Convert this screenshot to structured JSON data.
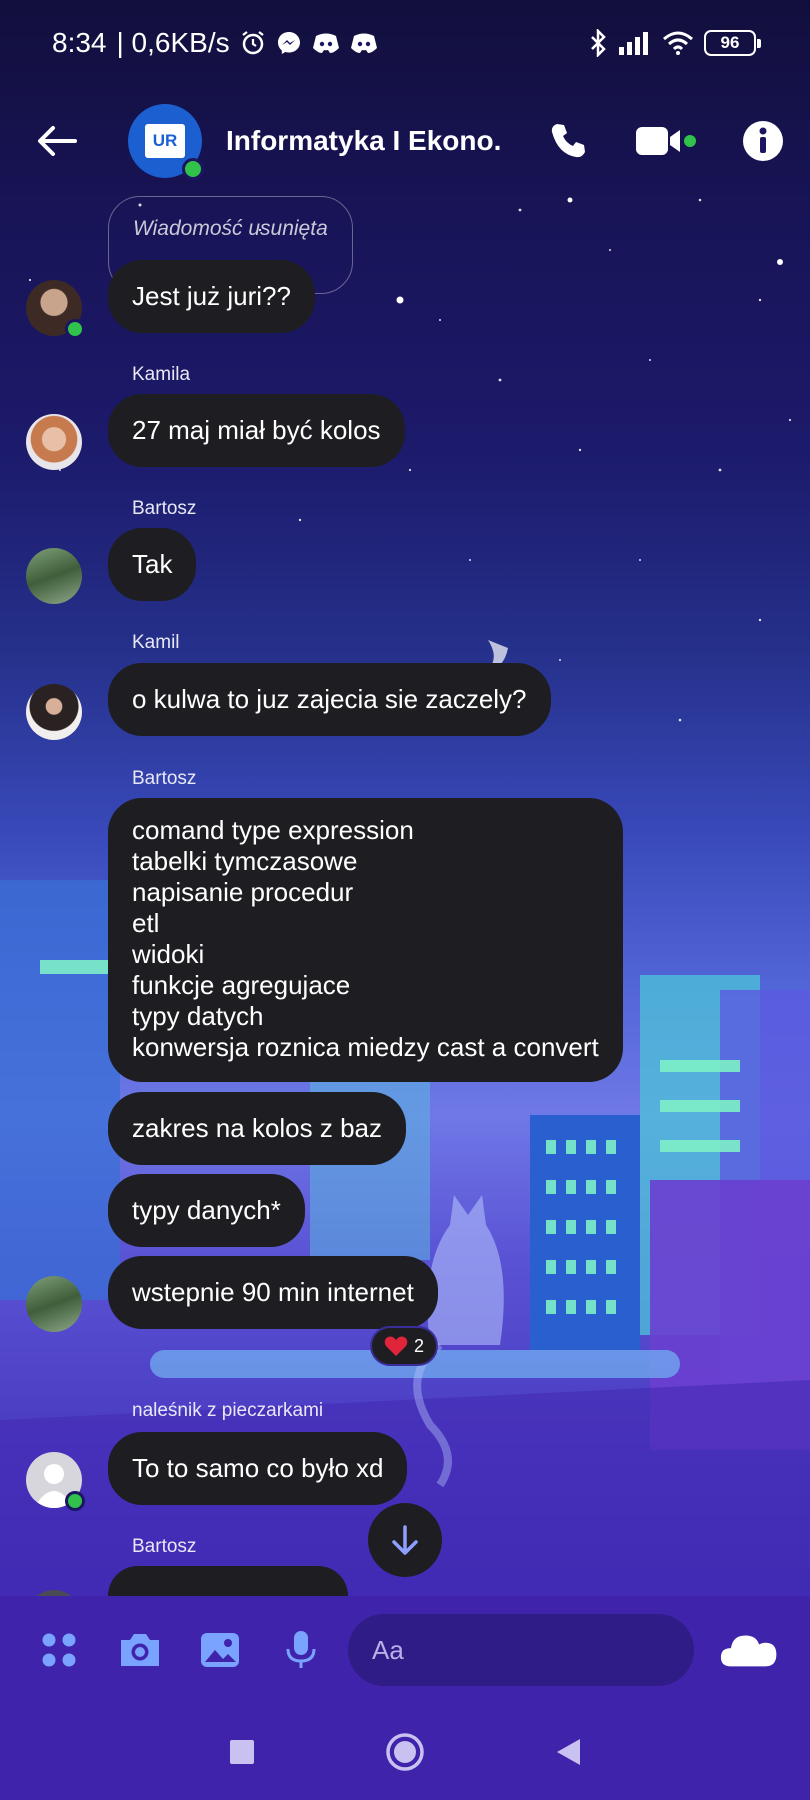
{
  "status_bar": {
    "time": "8:34",
    "speed": "| 0,6KB/s",
    "battery": "96",
    "icons": [
      "alarm-icon",
      "messenger-icon",
      "discord-icon",
      "discord-icon",
      "bluetooth-icon",
      "signal-icon",
      "wifi-icon",
      "battery-icon"
    ]
  },
  "header": {
    "title": "Informatyka I Ekono...",
    "avatar_logo": "UR",
    "icons": [
      "back-arrow-icon",
      "phone-icon",
      "video-camera-icon",
      "info-icon"
    ]
  },
  "messages": {
    "deleted": "Wiadomość usunięta",
    "m1": "Jest już juri??",
    "kamila_name": "Kamila",
    "m2": "27 maj miał być kolos",
    "bartosz_name": "Bartosz",
    "m3": "Tak",
    "kamil_name": "Kamil",
    "m4": "o kulwa to juz zajecia sie zaczely?",
    "bartosz_name_2": "Bartosz",
    "m5_lines": [
      "comand type expression",
      "tabelki tymczasowe",
      "napisanie procedur",
      "etl",
      "widoki",
      "funkcje agregujace",
      "typy datych",
      "konwersja roznica miedzy cast a convert"
    ],
    "m6": "zakres na kolos z baz",
    "m7": "typy danych*",
    "m8": "wstepnie 90 min internet",
    "reaction_count": "2",
    "nalesnik_name": "naleśnik z pieczarkami",
    "m9": "To to samo co było xd",
    "bartosz_name_3": "Bartosz"
  },
  "composer": {
    "placeholder": "Aa",
    "icons": [
      "menu-dots-icon",
      "camera-icon",
      "gallery-icon",
      "microphone-icon",
      "emoji-icon",
      "cloud-like-icon"
    ]
  },
  "nav": {
    "icons": [
      "recent-apps-icon",
      "home-icon",
      "back-icon"
    ]
  }
}
